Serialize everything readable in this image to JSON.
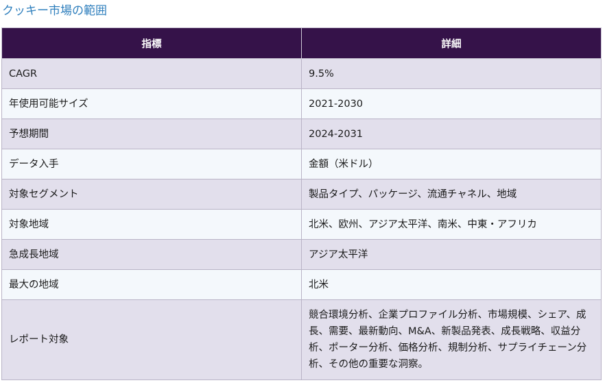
{
  "title": "クッキー市場の範囲",
  "table": {
    "headers": [
      "指標",
      "詳細"
    ],
    "rows": [
      {
        "metric": "CAGR",
        "detail": "9.5%"
      },
      {
        "metric": "年使用可能サイズ",
        "detail": "2021-2030"
      },
      {
        "metric": "予想期間",
        "detail": "2024-2031"
      },
      {
        "metric": "データ入手",
        "detail": "金額（米ドル）"
      },
      {
        "metric": "対象セグメント",
        "detail": "製品タイプ、パッケージ、流通チャネル、地域"
      },
      {
        "metric": "対象地域",
        "detail": "北米、欧州、アジア太平洋、南米、中東・アフリカ"
      },
      {
        "metric": "急成長地域",
        "detail": "アジア太平洋"
      },
      {
        "metric": "最大の地域",
        "detail": "北米"
      },
      {
        "metric": "レポート対象",
        "detail": "競合環境分析、企業プロファイル分析、市場規模、シェア、成長、需要、最新動向、M&A、新製品発表、成長戦略、収益分析、ポーター分析、価格分析、規制分析、サプライチェーン分析、その他の重要な洞察。"
      }
    ]
  },
  "colors": {
    "title": "#2f7fbd",
    "header_bg": "#351249",
    "row_odd_bg": "#e2dfec",
    "row_even_bg": "#f4f8fc"
  }
}
